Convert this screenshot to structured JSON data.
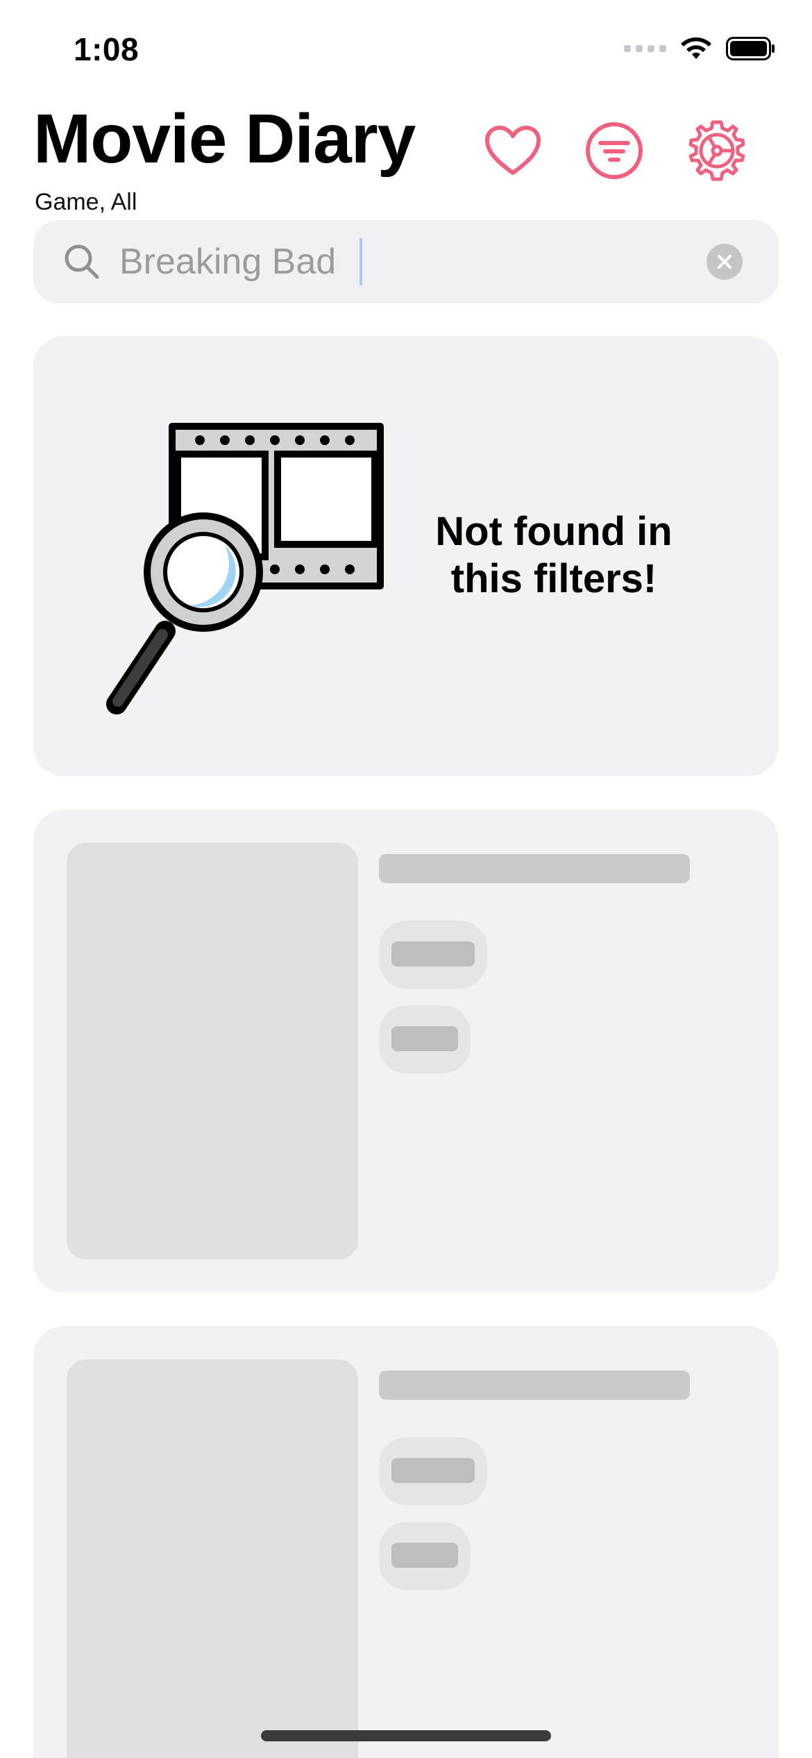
{
  "status_bar": {
    "time": "1:08",
    "wifi_icon": "wifi-icon",
    "battery_icon": "battery-icon"
  },
  "header": {
    "title": "Movie Diary",
    "subtitle": "Game, All",
    "favorites_icon": "heart-icon",
    "filter_icon": "filter-icon",
    "settings_icon": "gear-icon",
    "accent_color": "#f0617f"
  },
  "search": {
    "value": "Breaking Bad",
    "search_icon": "magnifier-icon",
    "clear_icon": "clear-icon"
  },
  "empty_state": {
    "message": "Not found in\nthis filters!",
    "illustration": "film-magnifier-illustration"
  },
  "placeholders": {
    "count": 2,
    "color_card": "#f1f1f6",
    "color_block": "#dfdfe4"
  }
}
